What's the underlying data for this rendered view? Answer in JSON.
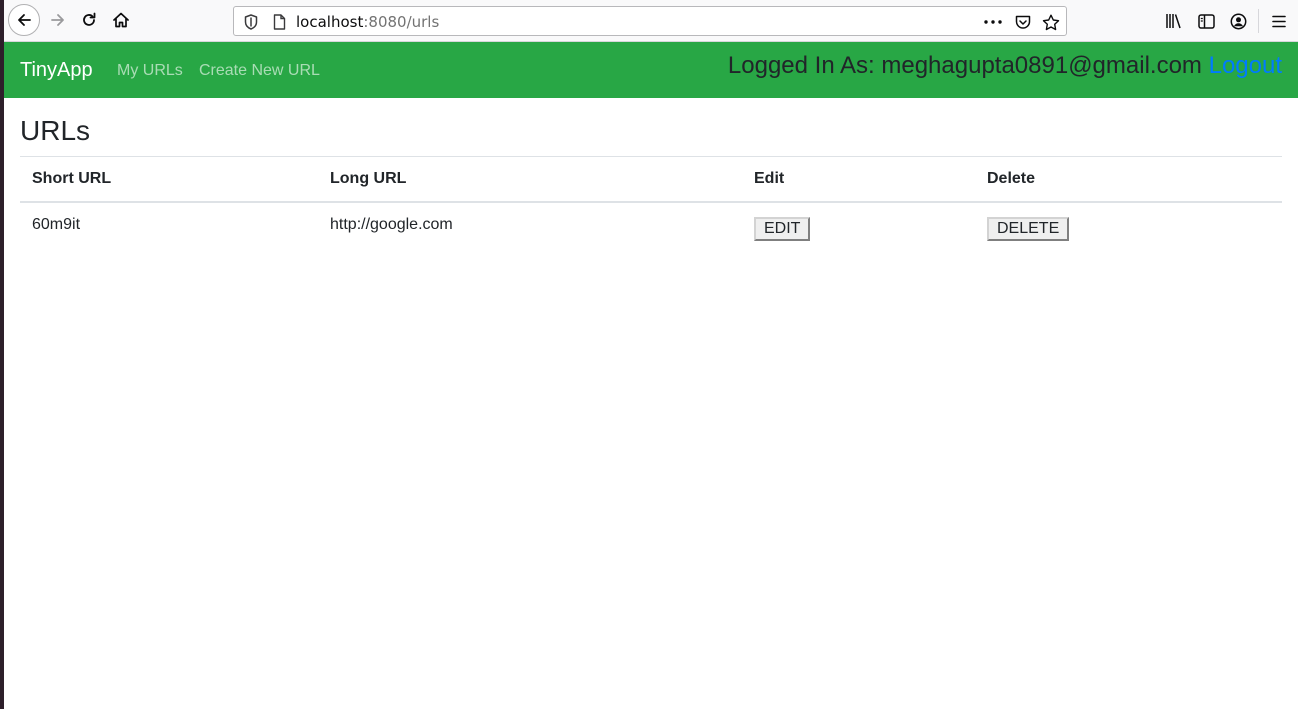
{
  "browser": {
    "url_host": "localhost",
    "url_rest": ":8080/urls"
  },
  "navbar": {
    "brand": "TinyApp",
    "links": [
      {
        "label": "My URLs"
      },
      {
        "label": "Create New URL"
      }
    ],
    "logged_in_label": "Logged In As: meghagupta0891@gmail.com",
    "logout_label": "Logout"
  },
  "main": {
    "title": "URLs",
    "columns": [
      "Short URL",
      "Long URL",
      "Edit",
      "Delete"
    ],
    "rows": [
      {
        "short_url": "60m9it",
        "long_url": "http://google.com",
        "edit_label": "EDIT",
        "delete_label": "DELETE"
      }
    ]
  },
  "colors": {
    "navbar": "#28a745",
    "link": "#007bff"
  },
  "icons": [
    "back-icon",
    "forward-icon",
    "reload-icon",
    "home-icon",
    "shield-icon",
    "page-icon",
    "more-icon",
    "pocket-icon",
    "star-icon",
    "library-icon",
    "sidebar-icon",
    "account-icon",
    "menu-icon"
  ]
}
